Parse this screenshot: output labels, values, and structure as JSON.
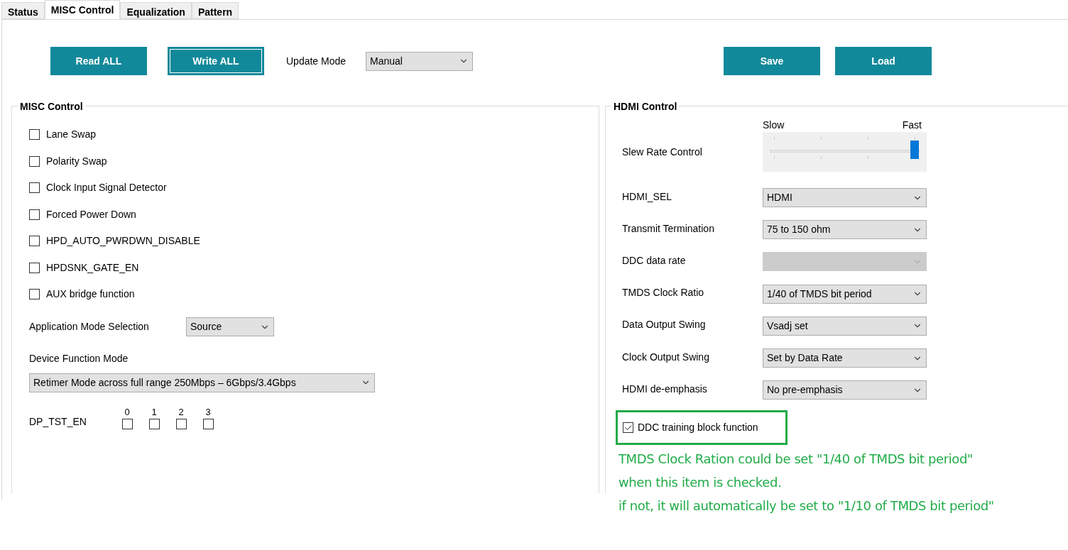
{
  "tabs": [
    {
      "label": "Status",
      "selected": false
    },
    {
      "label": "MISC Control",
      "selected": true
    },
    {
      "label": "Equalization",
      "selected": false
    },
    {
      "label": "Pattern",
      "selected": false
    }
  ],
  "toolbar": {
    "read_button": "Read ALL",
    "write_button": "Write ALL",
    "update_mode_label": "Update Mode",
    "update_mode_value": "Manual",
    "save_button": "Save",
    "load_button": "Load"
  },
  "misc_control": {
    "title": "MISC Control",
    "checkboxes": [
      {
        "label": "Lane Swap",
        "checked": false
      },
      {
        "label": "Polarity Swap",
        "checked": false
      },
      {
        "label": "Clock Input Signal Detector",
        "checked": false
      },
      {
        "label": "Forced Power Down",
        "checked": false
      },
      {
        "label": "HPD_AUTO_PWRDWN_DISABLE",
        "checked": false
      },
      {
        "label": "HPDSNK_GATE_EN",
        "checked": false
      },
      {
        "label": "AUX bridge function",
        "checked": false
      }
    ],
    "application_mode": {
      "label": "Application Mode Selection",
      "value": "Source"
    },
    "device_function_mode": {
      "label": "Device Function Mode",
      "value": "Retimer Mode across full range 250Mbps – 6Gbps/3.4Gbps"
    },
    "dp_tst_en": {
      "label": "DP_TST_EN",
      "bits": [
        {
          "label": "0",
          "checked": false
        },
        {
          "label": "1",
          "checked": false
        },
        {
          "label": "2",
          "checked": false
        },
        {
          "label": "3",
          "checked": false
        }
      ]
    }
  },
  "hdmi_control": {
    "title": "HDMI Control",
    "slew_rate": {
      "label": "Slew Rate Control",
      "min_label": "Slow",
      "max_label": "Fast",
      "level": 1
    },
    "selects": [
      {
        "label": "HDMI_SEL",
        "value": "HDMI",
        "disabled": false
      },
      {
        "label": "Transmit Termination",
        "value": "75 to 150 ohm",
        "disabled": false
      },
      {
        "label": "DDC data rate",
        "disabled": true
      },
      {
        "label": "TMDS Clock Ratio",
        "value": "1/40 of TMDS bit period",
        "disabled": false
      },
      {
        "label": "Data Output Swing",
        "value": "Vsadj set",
        "disabled": false
      },
      {
        "label": "Clock Output Swing",
        "value": "Set by Data Rate",
        "disabled": false
      },
      {
        "label": "HDMI de-emphasis",
        "value": "No pre-emphasis",
        "disabled": false
      }
    ],
    "ddc_training": {
      "label": "DDC training block function",
      "checked": true
    }
  },
  "annotation": [
    "TMDS Clock Ration could be set \"1/40 of TMDS bit period\"",
    "when this item is checked.",
    "if not, it will automatically be set to \"1/10 of TMDS bit period\""
  ]
}
